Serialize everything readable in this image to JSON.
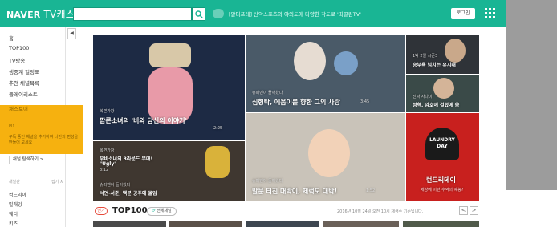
{
  "header": {
    "logo": "NAVER",
    "logo_product": "TV캐스트",
    "search_placeholder": "",
    "notice": "[알티프레] 산악스포츠와 야외도에 다양한 각도로 '떠끌린TV'",
    "login": "로그인",
    "colors": {
      "accent": "#19b594"
    }
  },
  "sidebar": {
    "items": [
      {
        "label": "홈"
      },
      {
        "label": "TOP100"
      },
      {
        "label": "TV방송"
      },
      {
        "label": "생중계 일정표"
      },
      {
        "label": "추천 채널목록"
      },
      {
        "label": "플레이리스트"
      }
    ],
    "highlight": {
      "label": "채스토어",
      "title": "MY",
      "desc": "구독 중인 채널을 추가하여 나만의 편성을 만들어 보세요"
    },
    "channel_button": "채널 탐색하기 >",
    "sub_head": "채널관",
    "sub_more": "접기 ∧",
    "sub_items": [
      {
        "label": "컴드리아"
      },
      {
        "label": "밀래잉"
      },
      {
        "label": "웨티"
      },
      {
        "label": "키즈"
      }
    ]
  },
  "tiles": [
    {
      "category": "복면가왕",
      "title": "팝콘소녀의 '비와 당신의 이야기'",
      "duration": "2:25"
    },
    {
      "category": "슈퍼맨이 돌아왔다",
      "title": "심형탁, 에움이를 향한 그의 사랑",
      "duration": "3:45"
    },
    {
      "category": "1박 2일 시즌3",
      "title": "승부욕 넘치는 유지태"
    },
    {
      "category": "진짜 사나이",
      "title": "성혁, 암호에 걸렸에 씀"
    },
    {
      "category": "복면가왕",
      "title": "우비소녀의 3라운드 무대!",
      "subtitle": "\"Ugly\"",
      "duration": "3:12",
      "category2": "슈퍼맨이 돌아왔다",
      "title2": "서언·서준, 백분 공주에 몰입"
    },
    {
      "category": "슈퍼맨이 돌아왔다",
      "title": "말문 터진 대박이, 제럭도 대박!",
      "duration": "1:52"
    },
    {
      "title": "런드리데이",
      "desc": "세상에 이런 추억의 예능?",
      "sign": "LAUNDRY DAY"
    }
  ],
  "top100": {
    "hot": "인기",
    "title": "TOP100",
    "chip": "전체채널",
    "timestamp": "2016년 10월 24일 오전 10시 재생수 기준입니다.",
    "prev": "<",
    "next": ">"
  }
}
